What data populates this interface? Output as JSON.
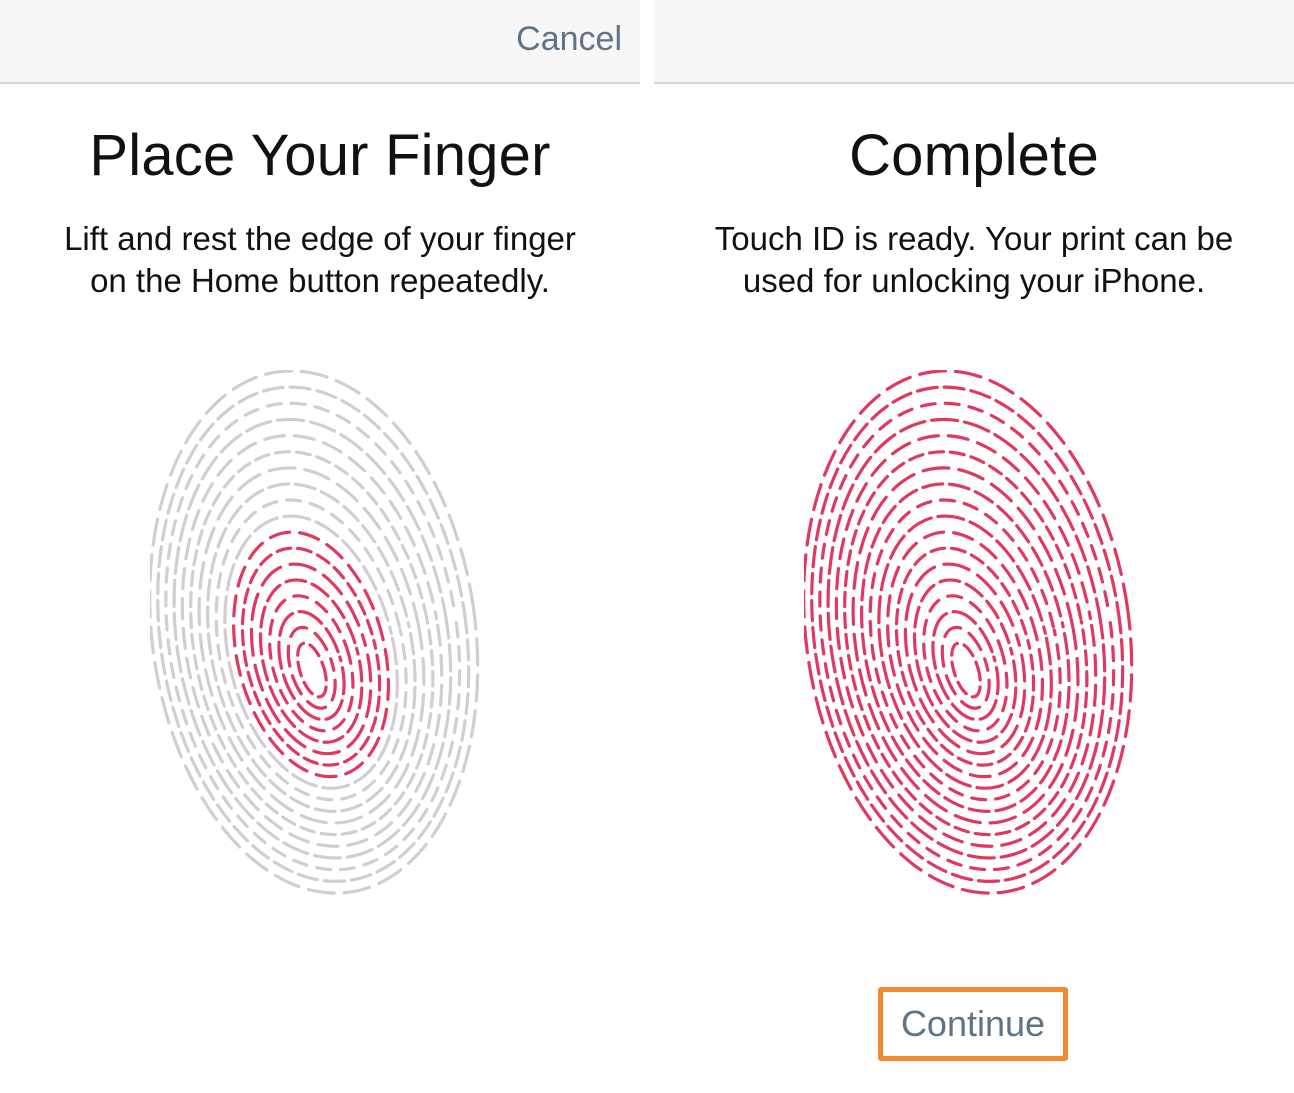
{
  "left_panel": {
    "nav": {
      "cancel_label": "Cancel"
    },
    "title": "Place Your Finger",
    "subtitle_line1": "Lift and rest the edge of your finger",
    "subtitle_line2": "on the Home button repeatedly.",
    "fingerprint": {
      "icon": "fingerprint-icon",
      "progress": 0.45
    }
  },
  "right_panel": {
    "title": "Complete",
    "subtitle_line1": "Touch ID is ready. Your print can be",
    "subtitle_line2": "used for unlocking your iPhone.",
    "fingerprint": {
      "icon": "fingerprint-icon",
      "progress": 1.0
    },
    "continue_label": "Continue"
  },
  "colors": {
    "accent_red": "#e0395f",
    "inactive_grey": "#d3cdd0",
    "link_blue_grey": "#5f7386",
    "highlight_orange": "#f08a2c",
    "navbar_bg": "#f7f7f7"
  }
}
